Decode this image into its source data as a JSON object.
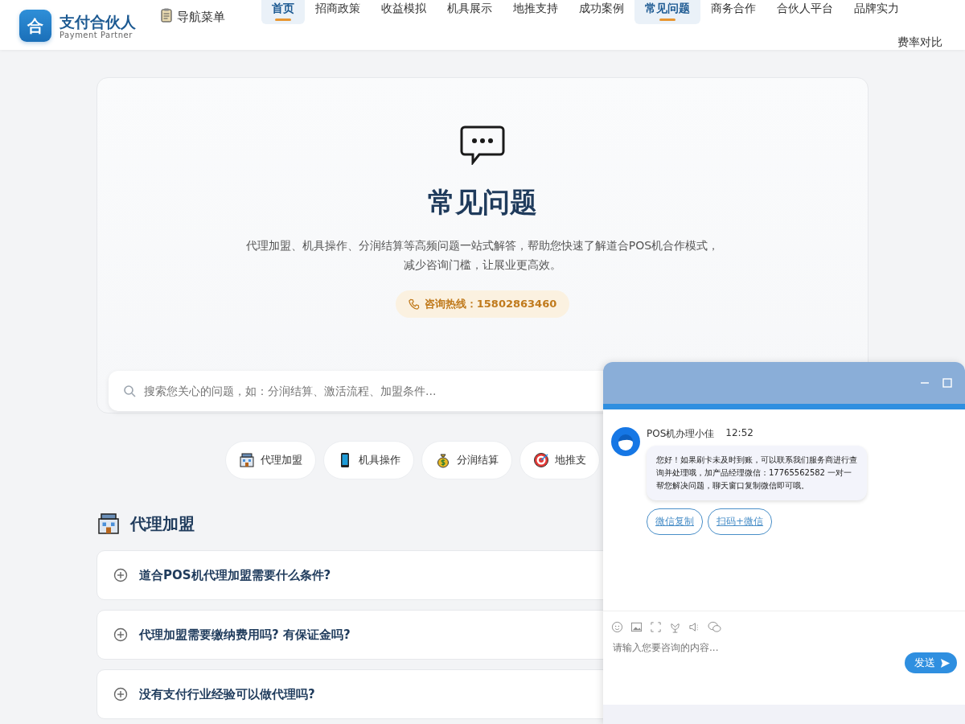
{
  "header": {
    "logo": {
      "mark": "合",
      "name": "支付合伙人",
      "tagline": "Payment Partner"
    },
    "menu_toggle": "导航菜单",
    "nav": [
      {
        "label": "首页",
        "selected": true
      },
      {
        "label": "招商政策",
        "selected": false
      },
      {
        "label": "收益模拟",
        "selected": false
      },
      {
        "label": "机具展示",
        "selected": false
      },
      {
        "label": "地推支持",
        "selected": false
      },
      {
        "label": "成功案例",
        "selected": false
      },
      {
        "label": "常见问题",
        "selected": true
      },
      {
        "label": "商务合作",
        "selected": false
      },
      {
        "label": "合伙人平台",
        "selected": false
      },
      {
        "label": "品牌实力",
        "selected": false
      },
      {
        "label": "费率对比",
        "selected": false
      }
    ]
  },
  "hero": {
    "title": "常见问题",
    "description": "代理加盟、机具操作、分润结算等高频问题一站式解答，帮助您快速了解道合POS机合作模式，减少咨询门槛，让展业更高效。",
    "hotline": "咨询热线：15802863460",
    "search": {
      "placeholder": "搜索您关心的问题，如：分润结算、激活流程、加盟条件..."
    }
  },
  "categories": [
    {
      "kind": "shop",
      "label": "代理加盟"
    },
    {
      "kind": "phone",
      "label": "机具操作"
    },
    {
      "kind": "money",
      "label": "分润结算"
    },
    {
      "kind": "target",
      "label": "地推支"
    }
  ],
  "section": {
    "kind": "shop",
    "title": "代理加盟",
    "questions": [
      {
        "text": "道合POS机代理加盟需要什么条件?",
        "expanded": false
      },
      {
        "text": "代理加盟需要缴纳费用吗? 有保证金吗?",
        "expanded": false
      },
      {
        "text": "没有支付行业经验可以做代理吗?",
        "expanded": false
      }
    ]
  },
  "chat": {
    "messages": [
      {
        "sender": "POS机办理小佳",
        "time": "12:52",
        "text": "您好！如果刷卡未及时到账，可以联系我们服务商进行查询并处理哦，加产品经理微信：17765562582 一对一帮您解决问题，聊天窗口复制微信即可哦。",
        "actions": [
          "微信复制",
          "扫码+微信"
        ]
      }
    ],
    "input": {
      "placeholder": "请输入您要咨询的内容..."
    },
    "send": "发送"
  }
}
